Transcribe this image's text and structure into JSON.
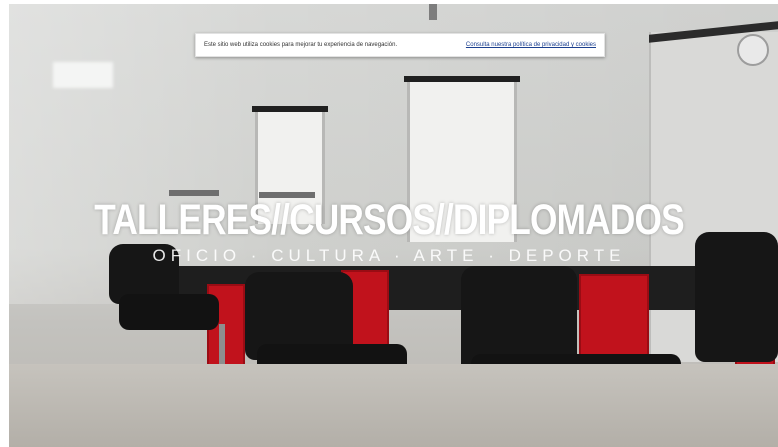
{
  "cookie_notice": {
    "message": "Este sitio web utiliza cookies para mejorar tu experiencia de navegación.",
    "link_label": "Consulta nuestra política de privacidad y cookies"
  },
  "hero": {
    "headline": "TALLERES//CURSOS//DIPLOMADOS",
    "subline": "OFICIO · CULTURA · ARTE · DEPORTE"
  }
}
